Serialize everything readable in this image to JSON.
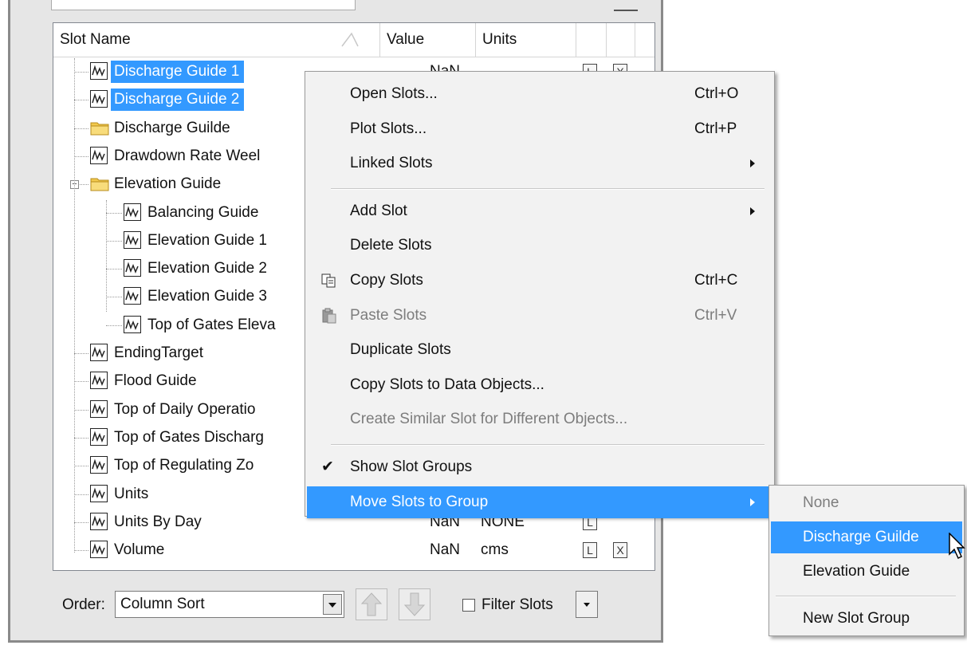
{
  "table": {
    "columns": [
      "Slot Name",
      "Value",
      "Units"
    ],
    "rows": [
      {
        "label": "Discharge Guide 1",
        "type": "slot",
        "selected": true,
        "value": "NaN",
        "units": "",
        "flags": [
          "L",
          "X"
        ]
      },
      {
        "label": "Discharge Guide 2",
        "type": "slot",
        "selected": true,
        "value": "",
        "units": "",
        "flags": []
      },
      {
        "label": "Discharge Guilde",
        "type": "folder",
        "selected": false,
        "value": "",
        "units": "",
        "flags": []
      },
      {
        "label": "Drawdown Rate Weel",
        "type": "slot",
        "selected": false,
        "value": "",
        "units": "",
        "flags": []
      },
      {
        "label": "Elevation Guide",
        "type": "folder",
        "selected": false,
        "value": "",
        "units": "",
        "flags": []
      },
      {
        "label": "Balancing Guide",
        "type": "slot",
        "selected": false,
        "value": "",
        "units": "",
        "flags": []
      },
      {
        "label": "Elevation Guide 1",
        "type": "slot",
        "selected": false,
        "value": "",
        "units": "",
        "flags": []
      },
      {
        "label": "Elevation Guide 2",
        "type": "slot",
        "selected": false,
        "value": "",
        "units": "",
        "flags": []
      },
      {
        "label": "Elevation Guide 3",
        "type": "slot",
        "selected": false,
        "value": "",
        "units": "",
        "flags": []
      },
      {
        "label": "Top of Gates Eleva",
        "type": "slot",
        "selected": false,
        "value": "",
        "units": "",
        "flags": []
      },
      {
        "label": "EndingTarget",
        "type": "slot",
        "selected": false,
        "value": "",
        "units": "",
        "flags": []
      },
      {
        "label": "Flood Guide",
        "type": "slot",
        "selected": false,
        "value": "",
        "units": "",
        "flags": []
      },
      {
        "label": "Top of Daily Operatio",
        "type": "slot",
        "selected": false,
        "value": "",
        "units": "",
        "flags": []
      },
      {
        "label": "Top of Gates Discharg",
        "type": "slot",
        "selected": false,
        "value": "",
        "units": "",
        "flags": []
      },
      {
        "label": "Top of Regulating Zo",
        "type": "slot",
        "selected": false,
        "value": "",
        "units": "",
        "flags": []
      },
      {
        "label": "Units",
        "type": "slot",
        "selected": false,
        "value": "",
        "units": "",
        "flags": []
      },
      {
        "label": "Units By Day",
        "type": "slot",
        "selected": false,
        "value": "NaN",
        "units": "NONE",
        "flags": [
          "L"
        ]
      },
      {
        "label": "Volume",
        "type": "slot",
        "selected": false,
        "value": "NaN",
        "units": "cms",
        "flags": [
          "L",
          "X"
        ]
      }
    ]
  },
  "bottom": {
    "order_label": "Order:",
    "order_value": "Column Sort",
    "filter_label": "Filter Slots"
  },
  "context_menu": {
    "items": [
      {
        "label": "Open Slots...",
        "shortcut": "Ctrl+O"
      },
      {
        "label": "Plot Slots...",
        "shortcut": "Ctrl+P"
      },
      {
        "label": "Linked Slots",
        "submenu": true
      },
      {
        "separator": true
      },
      {
        "label": "Add Slot",
        "submenu": true
      },
      {
        "label": "Delete Slots"
      },
      {
        "label": "Copy Slots",
        "shortcut": "Ctrl+C",
        "icon": "copy-icon"
      },
      {
        "label": "Paste Slots",
        "shortcut": "Ctrl+V",
        "disabled": true,
        "icon": "paste-icon"
      },
      {
        "label": "Duplicate Slots"
      },
      {
        "label": "Copy Slots to Data Objects..."
      },
      {
        "label": "Create Similar Slot for Different Objects...",
        "disabled": true
      },
      {
        "separator": true
      },
      {
        "label": "Show Slot Groups",
        "checked": true
      },
      {
        "label": "Move Slots to Group",
        "submenu": true,
        "highlighted": true
      }
    ]
  },
  "submenu": {
    "items": [
      {
        "label": "None",
        "disabled": true
      },
      {
        "label": "Discharge Guilde",
        "highlighted": true
      },
      {
        "label": "Elevation Guide"
      },
      {
        "separator": true
      },
      {
        "label": "New Slot Group"
      }
    ]
  },
  "colors": {
    "selection": "#3399ff",
    "menu_bg": "#f2f2f2",
    "disabled_text": "#7d7d7d"
  }
}
